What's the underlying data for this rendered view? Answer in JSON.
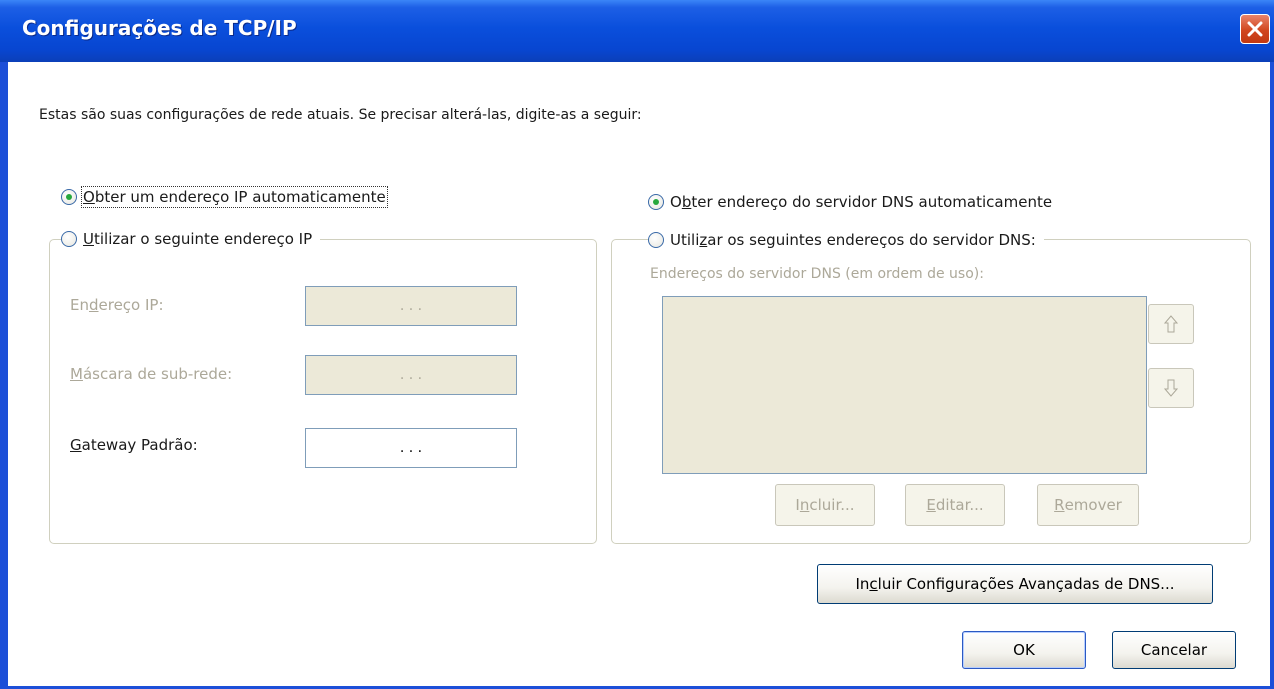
{
  "window": {
    "title": "Configurações de TCP/IP"
  },
  "intro_text": "Estas são suas configurações de rede atuais.  Se precisar alterá-las, digite-as a seguir:",
  "ip_section": {
    "auto_radio": {
      "pre": "",
      "ul": "O",
      "post": "bter um endereço IP automaticamente",
      "selected": true
    },
    "manual_radio": {
      "pre": "",
      "ul": "U",
      "post": "tilizar o seguinte endereço IP",
      "selected": false
    },
    "fields": [
      {
        "pre": "En",
        "ul": "d",
        "post": "ereço IP:",
        "value": ".   .   .",
        "enabled": false
      },
      {
        "pre": "",
        "ul": "M",
        "post": "áscara de sub-rede:",
        "value": ".   .   .",
        "enabled": false
      },
      {
        "pre": "",
        "ul": "G",
        "post": "ateway Padrão:",
        "value": ".   .   .",
        "enabled": true
      }
    ]
  },
  "dns_section": {
    "auto_radio": {
      "pre": "O",
      "ul": "b",
      "post": "ter endereço do servidor DNS automaticamente",
      "selected": true
    },
    "manual_radio": {
      "pre": "Utili",
      "ul": "z",
      "post": "ar os seguintes endereços do servidor DNS:",
      "selected": false
    },
    "list_label": "Endereços do servidor DNS (em ordem de uso):",
    "buttons": [
      {
        "pre": "I",
        "ul": "n",
        "post": "cluir..."
      },
      {
        "pre": "",
        "ul": "E",
        "post": "ditar..."
      },
      {
        "pre": "",
        "ul": "R",
        "post": "emover"
      }
    ]
  },
  "advanced_button": {
    "pre": "In",
    "ul": "c",
    "post": "luir Configurações Avançadas de DNS..."
  },
  "ok_button": "OK",
  "cancel_button": "Cancelar",
  "colors": {
    "titlebar": "#0a4fdc",
    "disabled_text": "#aca899",
    "disabled_bg": "#ece9d8",
    "radio_dot": "#27a83d"
  }
}
